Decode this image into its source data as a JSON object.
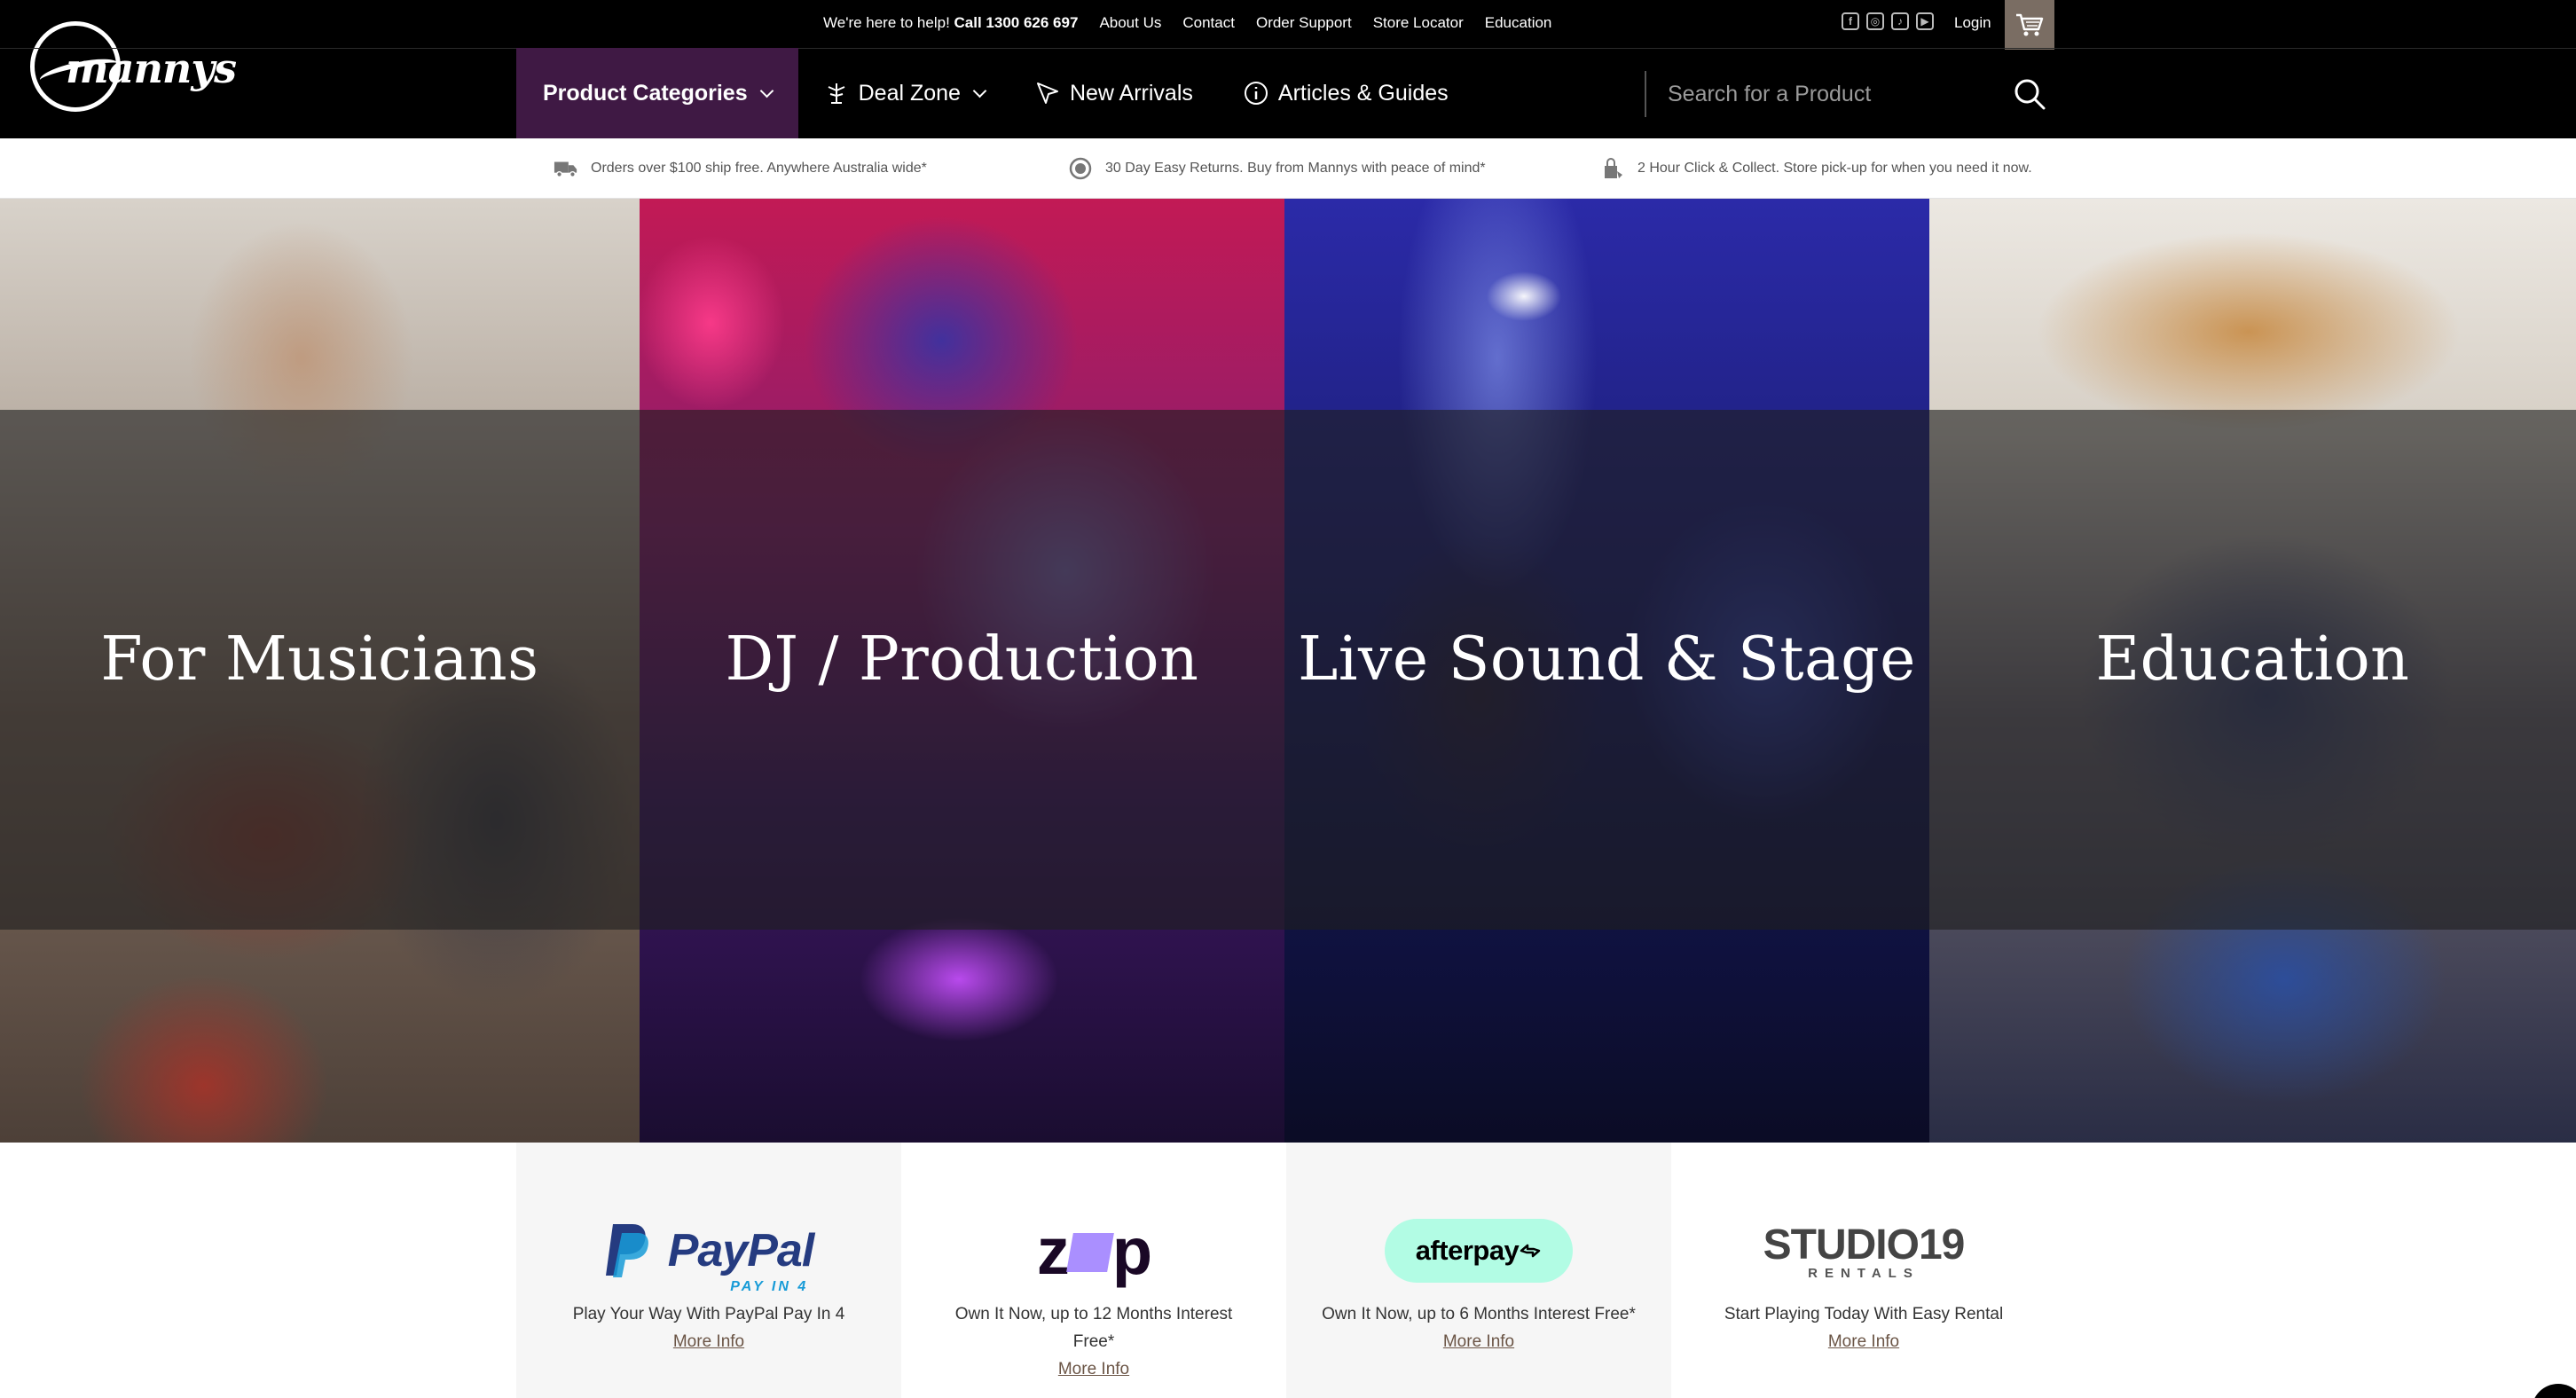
{
  "header": {
    "logo_text": "mannys",
    "utility": {
      "help_prefix": "We're here to help!",
      "help_phone": "Call 1300 626 697",
      "links": [
        "About Us",
        "Contact",
        "Order Support",
        "Store Locator",
        "Education"
      ],
      "social_icons": [
        "facebook-icon",
        "instagram-icon",
        "tiktok-icon",
        "youtube-icon"
      ],
      "login_label": "Login",
      "cart_icon": "cart-icon"
    },
    "nav": {
      "product_categories": "Product Categories",
      "deal_zone": "Deal Zone",
      "new_arrivals": "New Arrivals",
      "articles_guides": "Articles & Guides"
    },
    "search": {
      "placeholder": "Search for a Product"
    }
  },
  "usp": [
    {
      "icon": "truck-icon",
      "text": "Orders over $100 ship free. Anywhere Australia wide*"
    },
    {
      "icon": "return-icon",
      "text": "30 Day Easy Returns. Buy from Mannys with peace of mind*"
    },
    {
      "icon": "store-pickup-icon",
      "text": "2 Hour Click & Collect. Store pick-up for when you need it now."
    }
  ],
  "hero": {
    "tiles": [
      {
        "title": "For Musicians"
      },
      {
        "title": "DJ / Production"
      },
      {
        "title": "Live Sound & Stage"
      },
      {
        "title": "Education"
      }
    ]
  },
  "payments": [
    {
      "logo": "PayPal",
      "logo_sub": "PAY IN 4",
      "desc": "Play Your Way With PayPal Pay In 4",
      "more": "More Info"
    },
    {
      "logo": "zip",
      "desc": "Own It Now, up to 12 Months Interest Free*",
      "more": "More Info"
    },
    {
      "logo": "afterpay",
      "desc": "Own It Now, up to 6 Months Interest Free*",
      "more": "More Info"
    },
    {
      "logo": "STUDIO19",
      "logo_sub": "RENTALS",
      "desc": "Start Playing Today With Easy Rental",
      "more": "More Info"
    }
  ],
  "colors": {
    "header_bg": "#000000",
    "nav_active_bg": "#3f1944",
    "cart_bg": "#7a6d63",
    "link_brown": "#6b5546"
  }
}
